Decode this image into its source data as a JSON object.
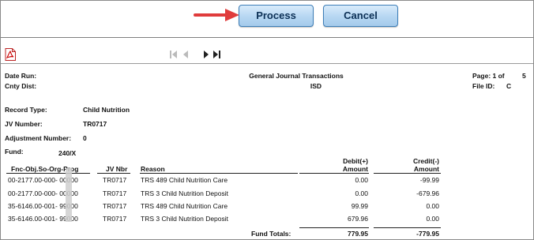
{
  "buttons": {
    "process": "Process",
    "cancel": "Cancel"
  },
  "icons": {
    "pdf": "pdf-icon",
    "first": "first-page-icon",
    "prev": "prev-page-icon",
    "next": "next-page-icon",
    "last": "last-page-icon",
    "annotation": "red-arrow-icon"
  },
  "colors": {
    "button_border": "#3d7eb8",
    "button_fill": "#b6d6f2",
    "annotation_arrow": "#e03c3c"
  },
  "header": {
    "date_run_label": "Date Run:",
    "cnty_dist_label": "Cnty Dist:",
    "title": "General Journal Transactions",
    "district": "ISD",
    "page_label": "Page: 1 of",
    "page_total": "5",
    "file_id_label": "File ID:",
    "file_id_value": "C"
  },
  "fields": {
    "record_type_label": "Record Type:",
    "record_type_value": "Child Nutrition",
    "jv_number_label": "JV Number:",
    "jv_number_value": "TR0717",
    "adjustment_label": "Adjustment Number:",
    "adjustment_value": "0",
    "fund_label": "Fund:",
    "fund_value": "240/X"
  },
  "columns": {
    "account": "Fnc-Obj.So-Org-Prog",
    "jv_nbr": "JV Nbr",
    "reason": "Reason",
    "debit_line1": "Debit(+)",
    "debit_line2": "Amount",
    "credit_line1": "Credit(-)",
    "credit_line2": "Amount"
  },
  "rows": [
    {
      "account": "00-2177.00-000-  00000",
      "jv": "TR0717",
      "reason": "TRS 489 Child Nutrition Care",
      "debit": "0.00",
      "credit": "-99.99"
    },
    {
      "account": "00-2177.00-000-  00000",
      "jv": "TR0717",
      "reason": "TRS 3 Child Nutrition Deposit",
      "debit": "0.00",
      "credit": "-679.96"
    },
    {
      "account": "35-6146.00-001-  99000",
      "jv": "TR0717",
      "reason": "TRS 489 Child Nutrition Care",
      "debit": "99.99",
      "credit": "0.00"
    },
    {
      "account": "35-6146.00-001-  99000",
      "jv": "TR0717",
      "reason": "TRS 3 Child Nutrition Deposit",
      "debit": "679.96",
      "credit": "0.00"
    }
  ],
  "totals": {
    "label": "Fund Totals:",
    "debit": "779.95",
    "credit": "-779.95"
  }
}
